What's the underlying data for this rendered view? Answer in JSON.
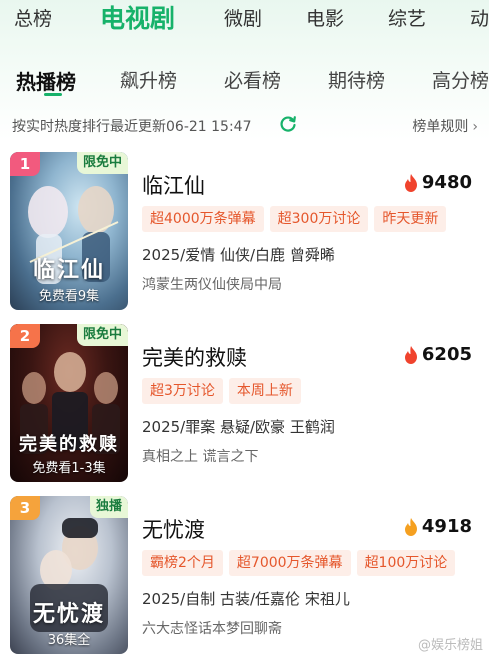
{
  "nav": {
    "items": [
      "总榜",
      "电视剧",
      "微剧",
      "电影",
      "综艺",
      "动"
    ],
    "active": "电视剧"
  },
  "sub_tabs": [
    "热播榜",
    "飙升榜",
    "必看榜",
    "期待榜",
    "高分榜"
  ],
  "update": {
    "text": "按实时热度排行最近更新06-21 15:47",
    "rules_label": "榜单规则",
    "rules_chevron": "›"
  },
  "colors": {
    "accent": "#17b26a",
    "tag_text": "#e5572c",
    "tag_bg": "#fdeee8",
    "badge_bg": "#e8f7d7"
  },
  "items": [
    {
      "rank": "1",
      "rank_color": "#f25a7e",
      "badge": "限免中",
      "poster_title": "临江仙",
      "poster_caption": "免费看9集",
      "title": "临江仙",
      "heat": "9480",
      "tags": [
        "超4000万条弹幕",
        "超300万讨论",
        "昨天更新"
      ],
      "meta": "2025/爱情 仙侠/白鹿 曾舜晞",
      "desc": "鸿蒙生两仪仙侠局中局"
    },
    {
      "rank": "2",
      "rank_color": "#f6734a",
      "badge": "限免中",
      "poster_title": "完美的救赎",
      "poster_caption": "免费看1-3集",
      "title": "完美的救赎",
      "heat": "6205",
      "tags": [
        "超3万讨论",
        "本周上新"
      ],
      "meta": "2025/罪案 悬疑/欧豪 王鹤润",
      "desc": "真相之上 谎言之下"
    },
    {
      "rank": "3",
      "rank_color": "#f5a33c",
      "badge": "独播",
      "poster_title": "无忧渡",
      "poster_caption": "36集全",
      "title": "无忧渡",
      "heat": "4918",
      "tags": [
        "霸榜2个月",
        "超7000万条弹幕",
        "超100万讨论"
      ],
      "meta": "2025/自制 古装/任嘉伦 宋祖儿",
      "desc": "六大志怪话本梦回聊斋"
    }
  ],
  "watermark": "@娱乐榜姐"
}
